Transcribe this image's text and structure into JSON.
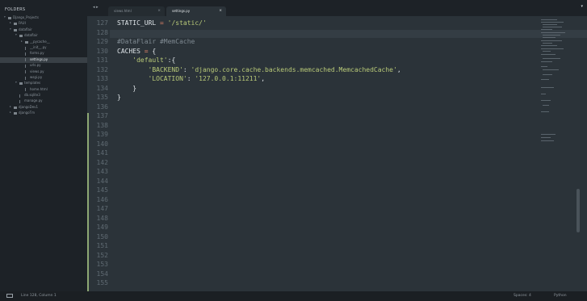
{
  "sidebar": {
    "header": "FOLDERS",
    "tree": [
      {
        "label": "Django_Projects",
        "depth": 0,
        "kind": "folder",
        "expanded": true
      },
      {
        "label": "FAUI",
        "depth": 1,
        "kind": "folder",
        "expanded": false
      },
      {
        "label": "dataflair",
        "depth": 1,
        "kind": "folder",
        "expanded": true
      },
      {
        "label": "dataflair",
        "depth": 2,
        "kind": "folder",
        "expanded": true
      },
      {
        "label": "__pycache__",
        "depth": 3,
        "kind": "folder",
        "expanded": false
      },
      {
        "label": "__init__.py",
        "depth": 3,
        "kind": "file"
      },
      {
        "label": "forms.py",
        "depth": 3,
        "kind": "file"
      },
      {
        "label": "settings.py",
        "depth": 3,
        "kind": "file",
        "active": true
      },
      {
        "label": "urls.py",
        "depth": 3,
        "kind": "file"
      },
      {
        "label": "views.py",
        "depth": 3,
        "kind": "file"
      },
      {
        "label": "wsgi.py",
        "depth": 3,
        "kind": "file"
      },
      {
        "label": "templates",
        "depth": 2,
        "kind": "folder",
        "expanded": true
      },
      {
        "label": "home.html",
        "depth": 3,
        "kind": "file"
      },
      {
        "label": "db.sqlite3",
        "depth": 2,
        "kind": "file"
      },
      {
        "label": "manage.py",
        "depth": 2,
        "kind": "file"
      },
      {
        "label": "djangoDev1",
        "depth": 1,
        "kind": "folder",
        "expanded": false
      },
      {
        "label": "djangoTm",
        "depth": 1,
        "kind": "folder",
        "expanded": false
      }
    ]
  },
  "tabs": [
    {
      "label": "views.html",
      "active": false
    },
    {
      "label": "settings.py",
      "active": true
    }
  ],
  "nav_arrows": "◂ ▸",
  "close_glyph": "×",
  "dropdown_glyph": "▾",
  "editor": {
    "lines": [
      {
        "num": "127",
        "tokens": [
          {
            "t": "STATIC_URL",
            "c": "#dfe5e9"
          },
          {
            "t": " = ",
            "c": "#e8896b"
          },
          {
            "t": "'/static/'",
            "c": "#b8c978"
          }
        ]
      },
      {
        "num": "128",
        "tokens": []
      },
      {
        "num": "129",
        "tokens": [
          {
            "t": "#DataFlair #MemCache",
            "c": "#7f8a92"
          }
        ]
      },
      {
        "num": "130",
        "tokens": [
          {
            "t": "CACHES",
            "c": "#dfe5e9"
          },
          {
            "t": " = ",
            "c": "#e8896b"
          },
          {
            "t": "{",
            "c": "#dfe5e9"
          }
        ]
      },
      {
        "num": "131",
        "tokens": [
          {
            "t": "    ",
            "c": "#dfe5e9"
          },
          {
            "t": "'default'",
            "c": "#b8c978"
          },
          {
            "t": ":{",
            "c": "#dfe5e9"
          }
        ]
      },
      {
        "num": "132",
        "tokens": [
          {
            "t": "        ",
            "c": "#dfe5e9"
          },
          {
            "t": "'BACKEND'",
            "c": "#b8c978"
          },
          {
            "t": ": ",
            "c": "#dfe5e9"
          },
          {
            "t": "'django.core.cache.backends.memcached.MemcachedCache'",
            "c": "#b8c978"
          },
          {
            "t": ",",
            "c": "#dfe5e9"
          }
        ]
      },
      {
        "num": "133",
        "tokens": [
          {
            "t": "        ",
            "c": "#dfe5e9"
          },
          {
            "t": "'LOCATION'",
            "c": "#b8c978"
          },
          {
            "t": ": ",
            "c": "#dfe5e9"
          },
          {
            "t": "'127.0.0.1:11211'",
            "c": "#b8c978"
          },
          {
            "t": ",",
            "c": "#dfe5e9"
          }
        ]
      },
      {
        "num": "134",
        "tokens": [
          {
            "t": "    }",
            "c": "#dfe5e9"
          }
        ]
      },
      {
        "num": "135",
        "tokens": [
          {
            "t": "}",
            "c": "#dfe5e9"
          }
        ]
      },
      {
        "num": "136",
        "tokens": []
      },
      {
        "num": "137",
        "tokens": []
      },
      {
        "num": "138",
        "tokens": []
      },
      {
        "num": "139",
        "tokens": []
      },
      {
        "num": "140",
        "tokens": []
      },
      {
        "num": "141",
        "tokens": []
      },
      {
        "num": "142",
        "tokens": []
      },
      {
        "num": "143",
        "tokens": []
      },
      {
        "num": "144",
        "tokens": []
      },
      {
        "num": "145",
        "tokens": []
      },
      {
        "num": "146",
        "tokens": []
      },
      {
        "num": "147",
        "tokens": []
      },
      {
        "num": "148",
        "tokens": []
      },
      {
        "num": "149",
        "tokens": []
      },
      {
        "num": "150",
        "tokens": []
      },
      {
        "num": "151",
        "tokens": []
      },
      {
        "num": "152",
        "tokens": []
      },
      {
        "num": "153",
        "tokens": []
      },
      {
        "num": "154",
        "tokens": []
      },
      {
        "num": "155",
        "tokens": []
      }
    ]
  },
  "statusbar": {
    "position": "Line 128, Column 1",
    "indent": "Spaces: 4",
    "syntax": "Python"
  },
  "colors": {
    "sidebar_bg": "#1d2227",
    "editor_bg": "#2b3339",
    "string": "#b8c978",
    "operator": "#e8896b",
    "comment": "#7f8a92",
    "diff_marker": "#8ea874"
  }
}
